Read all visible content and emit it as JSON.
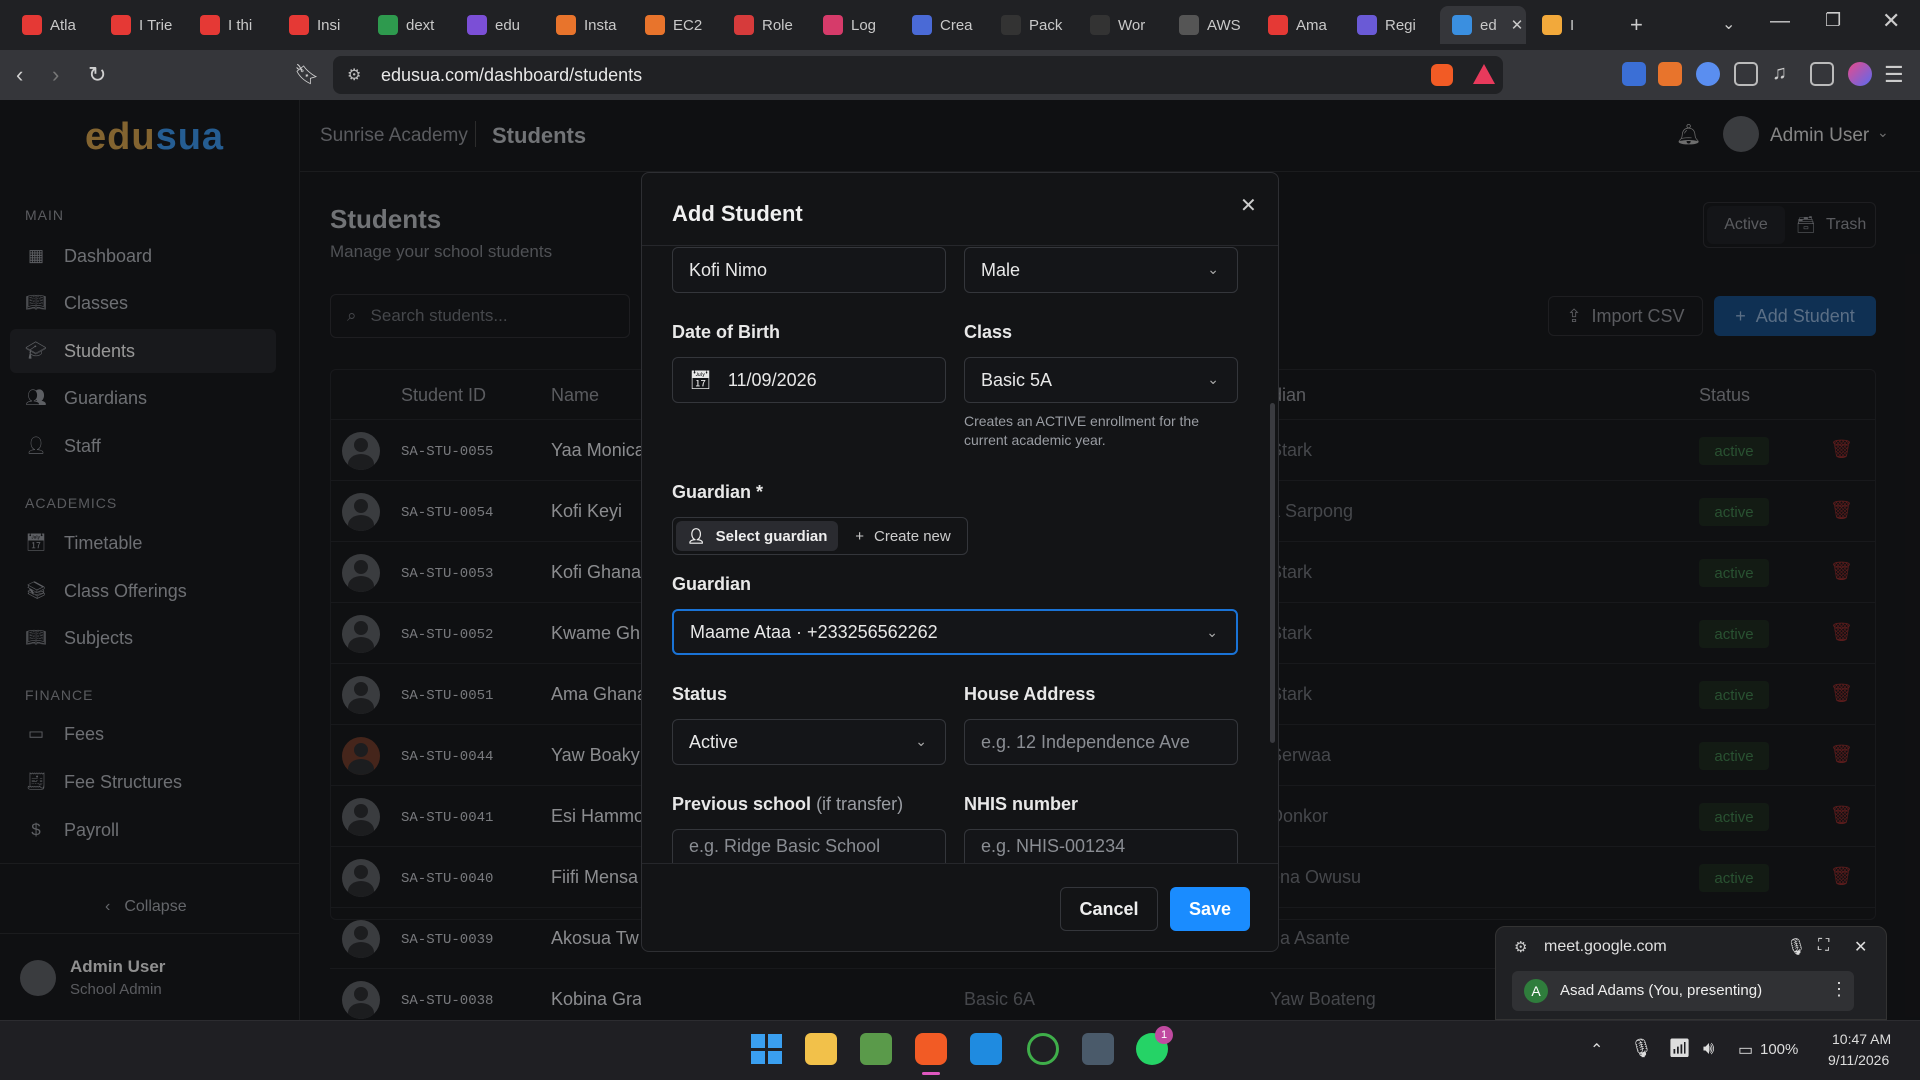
{
  "browser": {
    "tabs": [
      {
        "label": "Atla",
        "icon": "youtube-icon",
        "color": "#e53935"
      },
      {
        "label": "I Trie",
        "icon": "youtube-icon",
        "color": "#e53935"
      },
      {
        "label": "I thi",
        "icon": "youtube-icon",
        "color": "#e53935"
      },
      {
        "label": "Insi",
        "icon": "youtube-icon",
        "color": "#e53935"
      },
      {
        "label": "dext",
        "icon": "sheet-icon",
        "color": "#2e9a4e"
      },
      {
        "label": "edu",
        "icon": "app-icon",
        "color": "#7b4fd6"
      },
      {
        "label": "Insta",
        "icon": "app-icon",
        "color": "#e8742c"
      },
      {
        "label": "EC2",
        "icon": "aws-icon",
        "color": "#e8742c"
      },
      {
        "label": "Role",
        "icon": "app-icon",
        "color": "#d63b3b"
      },
      {
        "label": "Log",
        "icon": "app-icon",
        "color": "#d63b6a"
      },
      {
        "label": "Crea",
        "icon": "app-icon",
        "color": "#4a6ad6"
      },
      {
        "label": "Pack",
        "icon": "github-icon",
        "color": "#333333"
      },
      {
        "label": "Wor",
        "icon": "github-icon",
        "color": "#333333"
      },
      {
        "label": "AWS",
        "icon": "openai-icon",
        "color": "#555555"
      },
      {
        "label": "Ama",
        "icon": "youtube-icon",
        "color": "#e53935"
      },
      {
        "label": "Regi",
        "icon": "app-icon",
        "color": "#6a5ad6"
      },
      {
        "label": "ed",
        "icon": "edusua-icon",
        "color": "#3a8fe0"
      },
      {
        "label": "I",
        "icon": "meet-icon",
        "color": "#f2a93b"
      }
    ],
    "url": "edusua.com/dashboard/students"
  },
  "app": {
    "logo_a": "edu",
    "logo_b": "sua",
    "school": "Sunrise Academy",
    "page": "Students",
    "user": "Admin User",
    "sidebar": {
      "sections": [
        "MAIN",
        "ACADEMICS",
        "FINANCE"
      ],
      "items": [
        {
          "label": "Dashboard",
          "icon": "grid-icon"
        },
        {
          "label": "Classes",
          "icon": "book-icon"
        },
        {
          "label": "Students",
          "icon": "graduation-cap-icon"
        },
        {
          "label": "Guardians",
          "icon": "users-icon"
        },
        {
          "label": "Staff",
          "icon": "user-cog-icon"
        },
        {
          "label": "Timetable",
          "icon": "calendar-icon"
        },
        {
          "label": "Class Offerings",
          "icon": "library-icon"
        },
        {
          "label": "Subjects",
          "icon": "book-icon"
        },
        {
          "label": "Fees",
          "icon": "wallet-icon"
        },
        {
          "label": "Fee Structures",
          "icon": "receipt-icon"
        },
        {
          "label": "Payroll",
          "icon": "dollar-icon"
        }
      ],
      "collapse": "Collapse",
      "footer_name": "Admin User",
      "footer_role": "School Admin"
    },
    "main": {
      "title": "Students",
      "subtitle": "Manage your school students",
      "search_placeholder": "Search students...",
      "toggle_active": "Active",
      "toggle_trash": "Trash",
      "import": "Import CSV",
      "add": "Add Student",
      "headers": [
        "Student ID",
        "Name",
        "dian",
        "Status"
      ],
      "rows": [
        {
          "id": "SA-STU-0055",
          "name": "Yaa Monica",
          "guardian": "Stark",
          "status": "active"
        },
        {
          "id": "SA-STU-0054",
          "name": "Kofi Keyi",
          "guardian": "a Sarpong",
          "status": "active"
        },
        {
          "id": "SA-STU-0053",
          "name": "Kofi Ghana",
          "guardian": "Stark",
          "status": "active"
        },
        {
          "id": "SA-STU-0052",
          "name": "Kwame Gh",
          "guardian": "Stark",
          "status": "active"
        },
        {
          "id": "SA-STU-0051",
          "name": "Ama Ghana",
          "guardian": "Stark",
          "status": "active"
        },
        {
          "id": "SA-STU-0044",
          "name": "Yaw Boaky",
          "guardian": "Serwaa",
          "status": "active"
        },
        {
          "id": "SA-STU-0041",
          "name": "Esi Hammo",
          "guardian": "Donkor",
          "status": "active"
        },
        {
          "id": "SA-STU-0040",
          "name": "Fiifi Mensa",
          "guardian": "ena Owusu",
          "status": "active"
        },
        {
          "id": "SA-STU-0039",
          "name": "Akosua Tw",
          "guardian": "ua Asante",
          "status": ""
        },
        {
          "id": "SA-STU-0038",
          "name": "Kobina Grant",
          "class": "Basic 6A",
          "guardian": "Yaw Boateng",
          "status": ""
        }
      ]
    }
  },
  "modal": {
    "title": "Add Student",
    "name_value": "Kofi Nimo",
    "gender_value": "Male",
    "dob_label": "Date of Birth",
    "dob_value": "11/09/2026",
    "class_label": "Class",
    "class_value": "Basic 5A",
    "class_help": "Creates an ACTIVE enrollment for the current academic year.",
    "guardian_req_label": "Guardian *",
    "select_guardian": "Select guardian",
    "create_new": "Create new",
    "guardian_label": "Guardian",
    "guardian_value": "Maame Ataa · +233256562262",
    "status_label": "Status",
    "status_value": "Active",
    "address_label": "House Address",
    "address_placeholder": "e.g. 12 Independence Ave",
    "prev_label": "Previous school",
    "prev_sub": "(if transfer)",
    "prev_placeholder": "e.g. Ridge Basic School",
    "nhis_label": "NHIS number",
    "nhis_placeholder": "e.g. NHIS-001234",
    "cancel": "Cancel",
    "save": "Save"
  },
  "meet": {
    "domain": "meet.google.com",
    "presenter_initial": "A",
    "presenter": "Asad Adams (You, presenting)"
  },
  "taskbar": {
    "time": "10:47 AM",
    "date": "9/11/2026",
    "battery": "100%",
    "whatsapp_badge": "1"
  },
  "colors": {
    "accent": "#1a73d6",
    "save": "#1a8cff",
    "active_badge": "#3f7d4c"
  }
}
